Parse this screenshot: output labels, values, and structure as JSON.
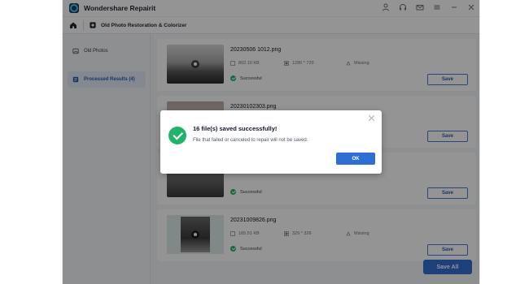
{
  "app": {
    "title": "Wondershare Repairit"
  },
  "nav": {
    "title": "Old Photo Restoration & Colorizer"
  },
  "sidebar": {
    "items": [
      {
        "label": "Old Photos"
      },
      {
        "label": "Processed Results (4)"
      }
    ]
  },
  "results": [
    {
      "filename": "20230506 1012.png",
      "size": "892.10  KB",
      "dimensions": "1280 * 720",
      "missing": "Missing",
      "status": "Successful",
      "save_label": "Save"
    },
    {
      "filename": "20230102303.png",
      "size": "",
      "dimensions": "",
      "missing": "",
      "status": "",
      "save_label": "Save"
    },
    {
      "filename": "",
      "size": "",
      "dimensions": "",
      "missing": "",
      "status": "Successful",
      "save_label": "Save"
    },
    {
      "filename": "20231009826.png",
      "size": "165.51  KB",
      "dimensions": "329 * 328",
      "missing": "Missing",
      "status": "Successful",
      "save_label": "Save"
    }
  ],
  "save_all_label": "Save All",
  "dialog": {
    "title": "16 file(s) saved successfully!",
    "message": "File that failed or canceled to repair will not be saved.",
    "ok_label": "OK"
  },
  "colors": {
    "accent": "#2f6ed2",
    "success": "#22b36b"
  },
  "icons": [
    "app-logo-icon",
    "user-icon",
    "headset-icon",
    "mail-icon",
    "menu-icon",
    "minimize-icon",
    "close-icon",
    "home-icon",
    "photo-icon",
    "results-icon",
    "file-size-icon",
    "dimensions-icon",
    "missing-icon",
    "success-check-icon"
  ]
}
